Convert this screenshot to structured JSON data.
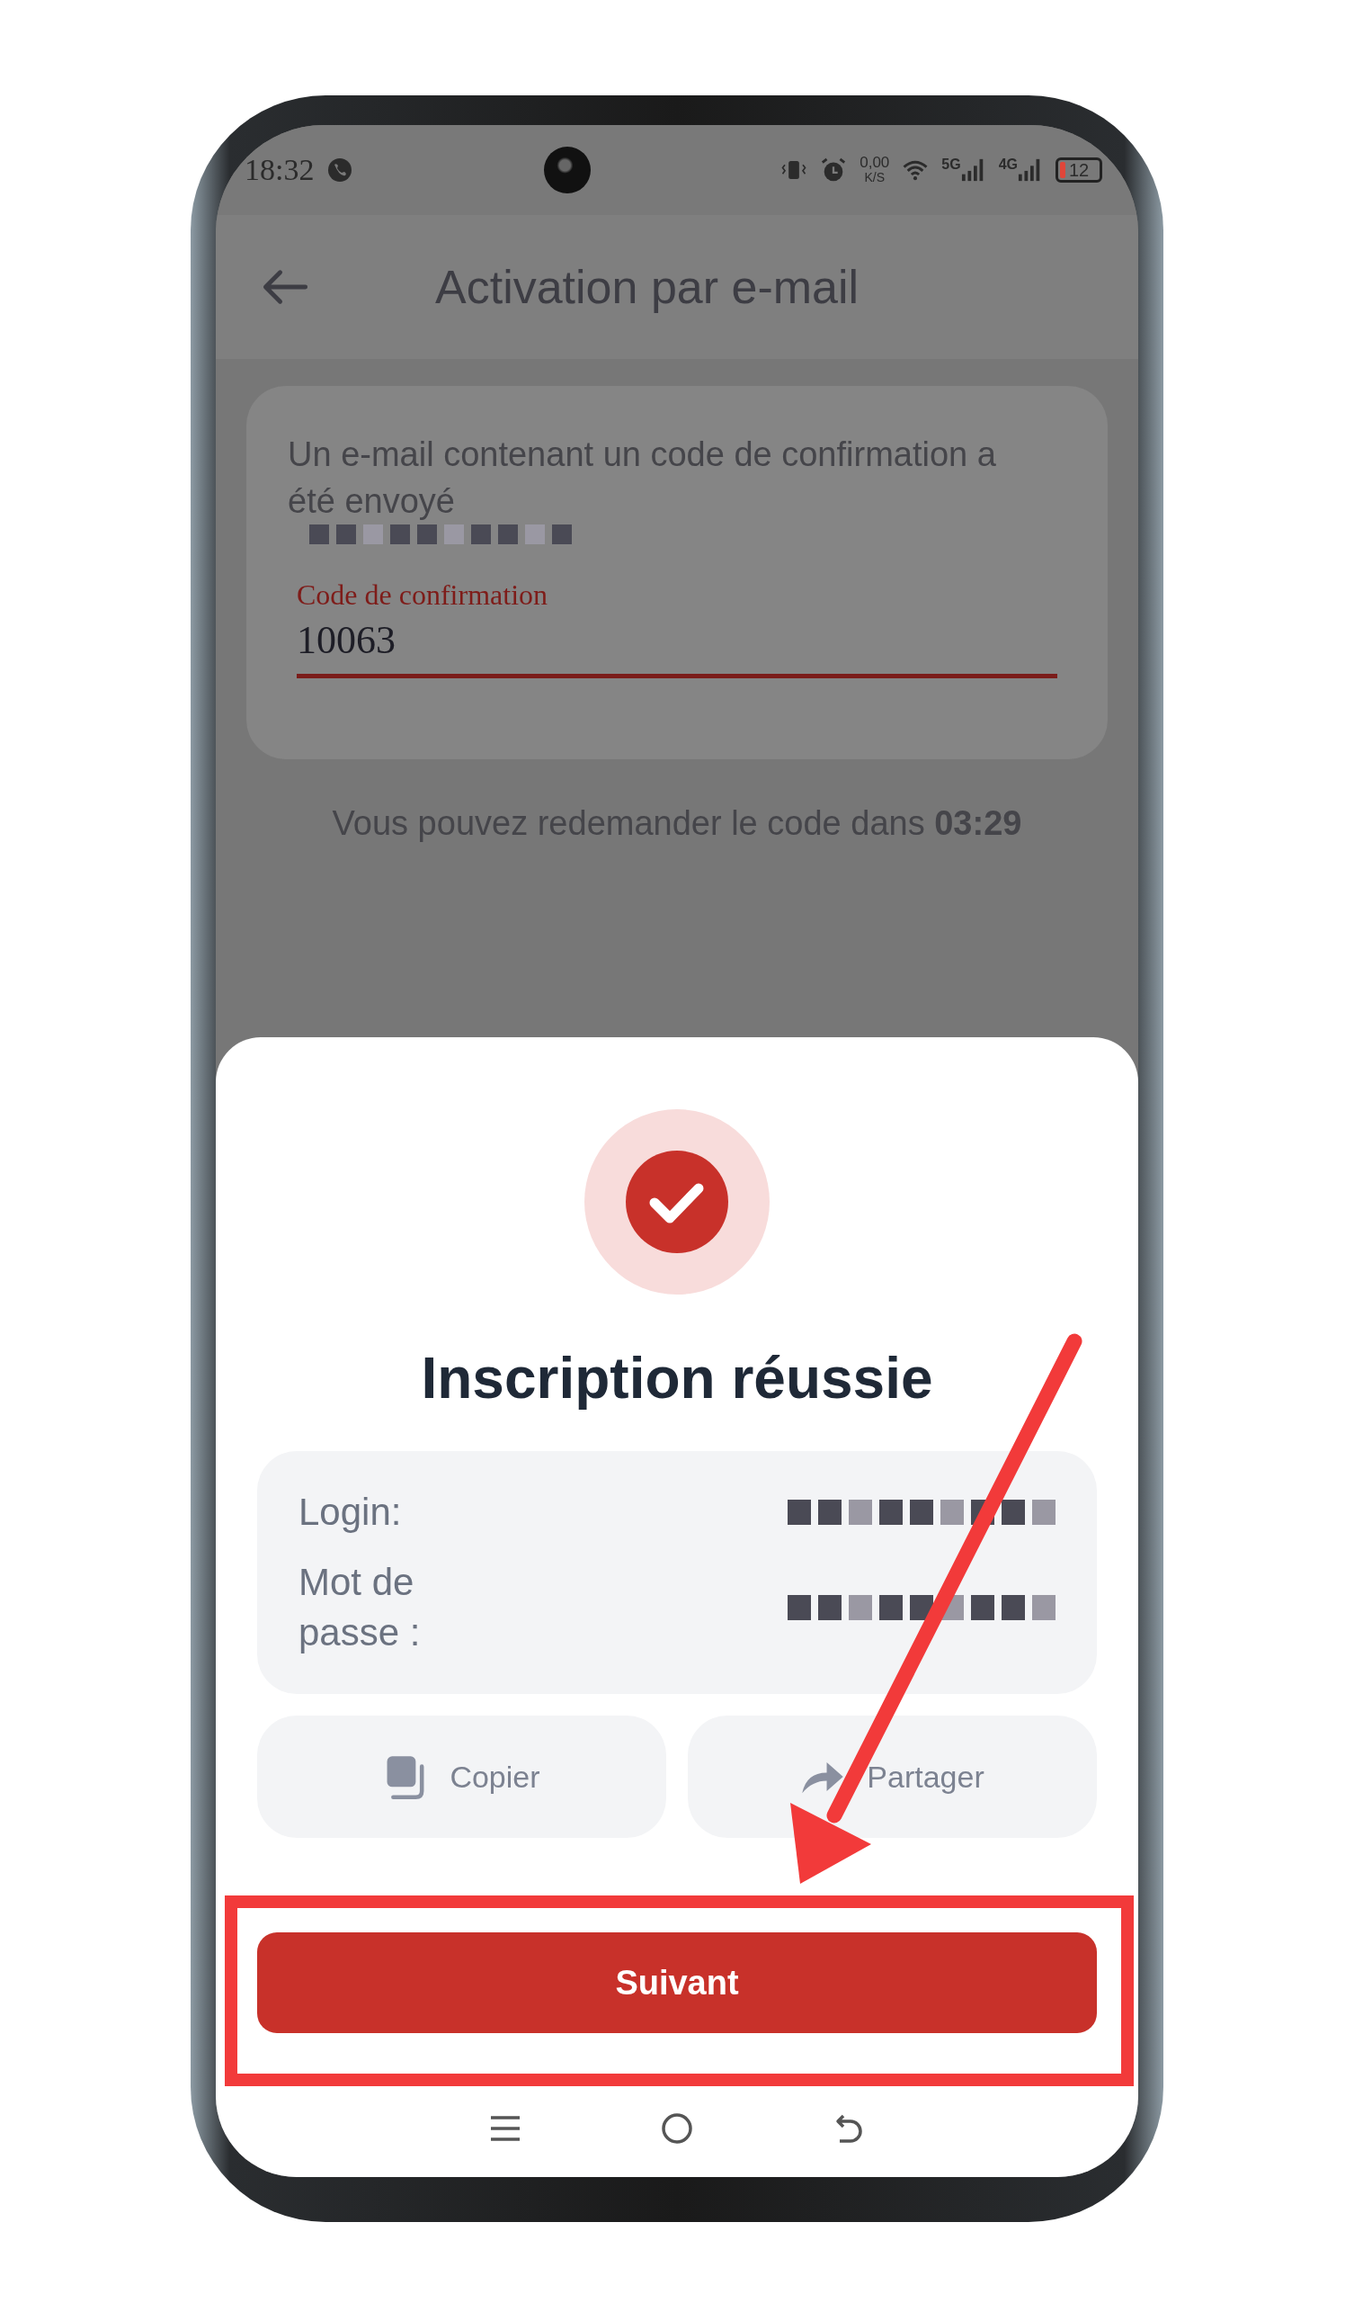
{
  "status_bar": {
    "time": "18:32",
    "net_speed": "0,00",
    "net_unit": "K/S",
    "networks": [
      {
        "label": "5G"
      },
      {
        "label": "4G"
      }
    ],
    "battery": {
      "text": "12",
      "level": 0.12
    }
  },
  "header": {
    "title": "Activation par e-mail"
  },
  "card": {
    "message": "Un e-mail contenant un code de confirmation a été envoyé",
    "field": {
      "label": "Code de confirmation",
      "value": "10063"
    }
  },
  "timer": "Vous pouvez redemander le code dans **03:29**",
  "dialog": {
    "title": "Inscription réussie",
    "credentials": [
      {
        "label": "Login:"
      },
      {
        "label": "Mot de passe :"
      }
    ],
    "actions": [
      {
        "label": "Copier",
        "kind": "copy"
      },
      {
        "label": "Partager",
        "kind": "share"
      }
    ],
    "primary": "Suivant"
  }
}
